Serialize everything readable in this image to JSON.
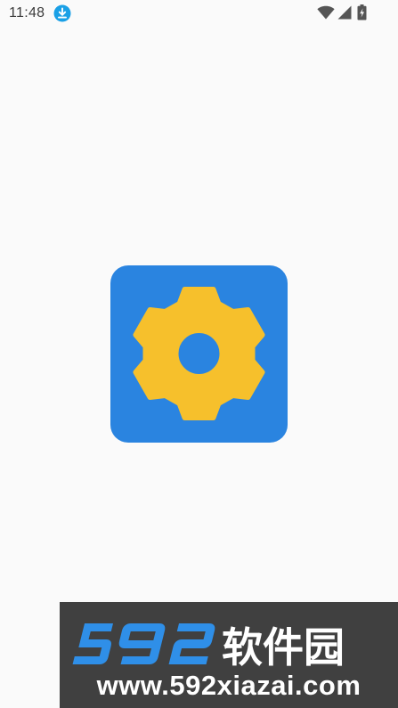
{
  "status_bar": {
    "time": "11:48",
    "icons": [
      "download-icon",
      "wifi-icon",
      "cell-signal-icon",
      "battery-charging-icon"
    ]
  },
  "splash": {
    "icon": "gear-settings-icon",
    "colors": {
      "tile": "#2a84e0",
      "gear": "#f6c02c",
      "background": "#fafafa"
    }
  },
  "watermark": {
    "brand": "592软件园",
    "url": "www.592xiazai.com",
    "colors": {
      "background": "#404040",
      "digits": "#2f8fe8",
      "text": "#ffffff"
    }
  }
}
